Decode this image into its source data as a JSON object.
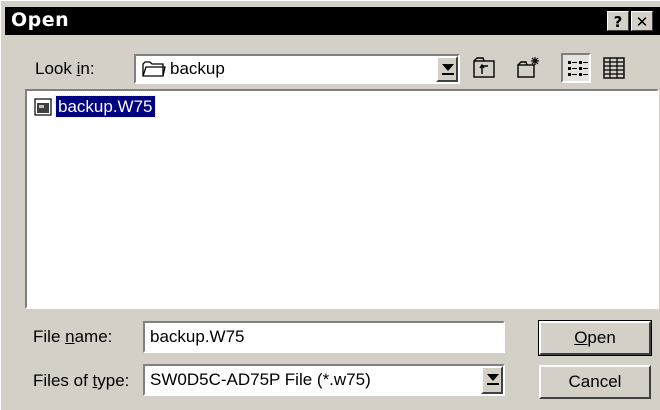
{
  "window": {
    "title": "Open"
  },
  "title_buttons": {
    "help": "?",
    "close": "✕"
  },
  "look_in": {
    "label_pre": "Look ",
    "label_u": "i",
    "label_post": "n:",
    "value": "backup"
  },
  "files": [
    {
      "name": "backup.W75",
      "selected": true
    }
  ],
  "file_name": {
    "label_pre": "File ",
    "label_u": "n",
    "label_post": "ame:",
    "value": "backup.W75"
  },
  "files_of_type": {
    "label_pre": "Files of ",
    "label_u": "t",
    "label_post": "ype:",
    "value": "SW0D5C-AD75P File (*.w75)"
  },
  "buttons": {
    "open_u": "O",
    "open_rest": "pen",
    "cancel": "Cancel"
  },
  "icons": [
    "folder-icon",
    "up-folder-icon",
    "new-folder-icon",
    "list-view-icon",
    "details-view-icon",
    "file-icon"
  ]
}
